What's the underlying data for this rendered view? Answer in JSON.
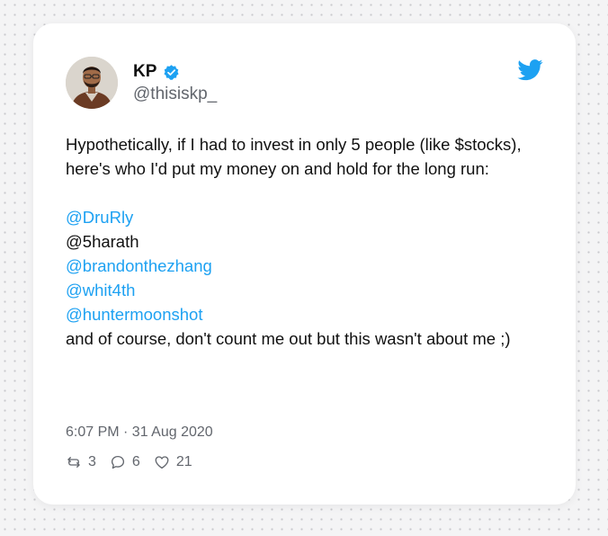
{
  "author": {
    "name": "KP",
    "handle": "@thisiskp_",
    "verified": true
  },
  "tweet": {
    "intro": "Hypothetically, if I had to invest in only 5 people (like $stocks), here's who I'd put my money on and hold for the long run:",
    "mentions": [
      {
        "text": "@DruRly",
        "linked": true
      },
      {
        "text": "@5harath",
        "linked": false
      },
      {
        "text": "@brandonthezhang",
        "linked": true
      },
      {
        "text": "@whit4th",
        "linked": true
      },
      {
        "text": "@huntermoonshot",
        "linked": true
      }
    ],
    "closing": "and of course, don't count me out but this wasn't about me ;)"
  },
  "meta": {
    "timestamp": "6:07 PM · 31 Aug 2020"
  },
  "stats": {
    "retweets": "3",
    "replies": "6",
    "likes": "21"
  },
  "icons": {
    "brand": "twitter-bird-icon",
    "verified": "verified-badge-icon",
    "retweet": "retweet-icon",
    "reply": "reply-icon",
    "like": "heart-icon"
  },
  "colors": {
    "link": "#1da1f2",
    "brand": "#1da1f2",
    "muted": "#62666d",
    "text": "#111111"
  }
}
